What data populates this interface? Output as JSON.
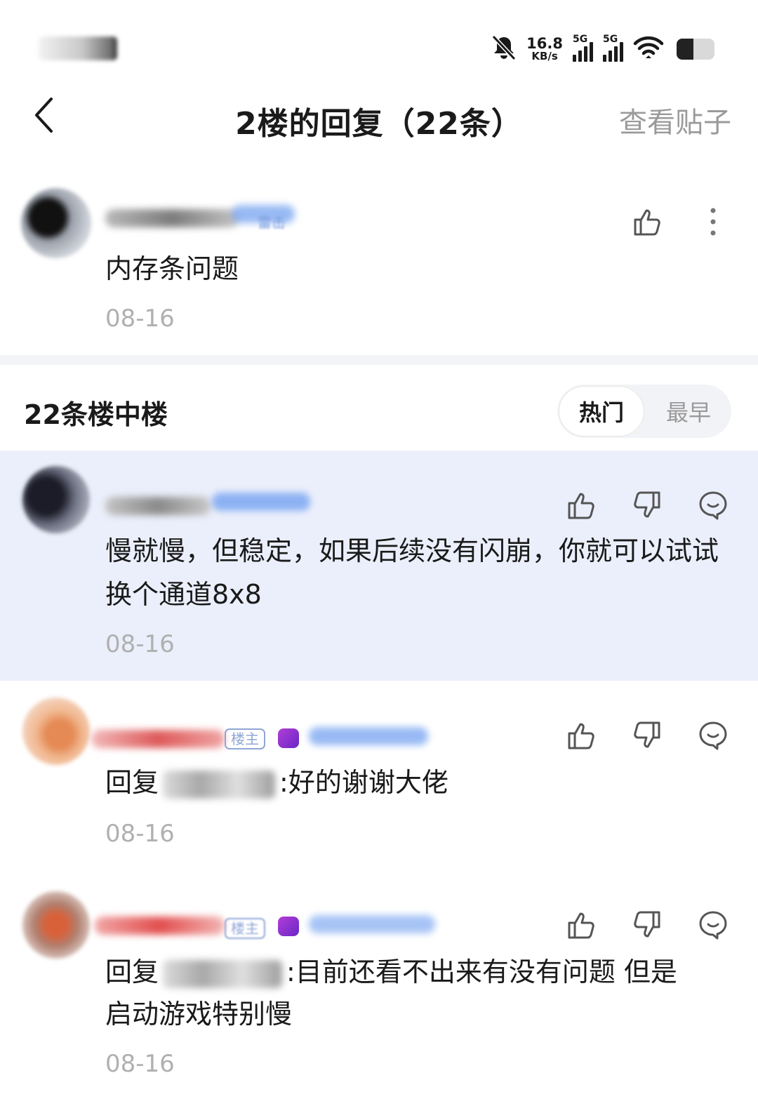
{
  "status_bar": {
    "net_speed_value": "16.8",
    "net_speed_unit": "KB/s",
    "sim1_label": "5G",
    "sim2_label": "5G",
    "battery_level": 0.45
  },
  "nav": {
    "title": "2楼的回复（22条）",
    "view_post": "查看贴子"
  },
  "main_post": {
    "badge": "雷击",
    "text": "内存条问题",
    "date": "08-16"
  },
  "replies_header": {
    "title": "22条楼中楼",
    "sort_hot": "热门",
    "sort_earliest": "最早"
  },
  "replies": [
    {
      "text": "慢就慢，但稳定，如果后续没有闪崩，你就可以试试换个通道8x8",
      "date": "08-16"
    },
    {
      "badge": "楼主",
      "reply_prefix": "回复",
      "text": ":好的谢谢大佬",
      "date": "08-16"
    },
    {
      "badge": "楼主",
      "reply_prefix": "回复",
      "text": ":目前还看不出来有没有问题 但是",
      "text_line2": "启动游戏特别慢",
      "date": "08-16"
    }
  ],
  "colors": {
    "highlight_bg": "#ebeffb",
    "muted_text": "#9a9a9a",
    "date_text": "#b0b0b0"
  }
}
